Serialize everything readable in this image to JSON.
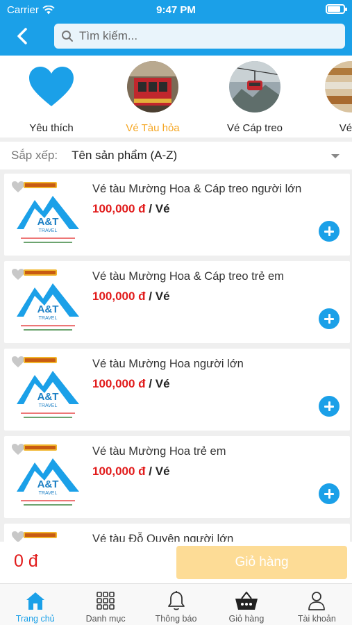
{
  "status_bar": {
    "carrier": "Carrier",
    "time": "9:47 PM"
  },
  "header": {
    "search_placeholder": "Tìm kiếm..."
  },
  "categories": [
    {
      "label": "Yêu thích",
      "icon": "heart-icon",
      "active": false
    },
    {
      "label": "Vé Tàu hỏa",
      "icon": "train-photo",
      "active": true
    },
    {
      "label": "Vé Cáp treo",
      "icon": "cable-car-photo",
      "active": false
    },
    {
      "label": "Vé B",
      "icon": "food-photo",
      "active": false
    }
  ],
  "sort": {
    "label": "Sắp xếp:",
    "value": "Tên sản phẩm (A-Z)"
  },
  "products": [
    {
      "name": "Vé tàu Mường Hoa & Cáp treo người lớn",
      "price": "100,000 đ",
      "unit": " / Vé"
    },
    {
      "name": "Vé tàu Mường Hoa & Cáp treo trẻ em",
      "price": "100,000 đ",
      "unit": " / Vé"
    },
    {
      "name": "Vé tàu Mường Hoa người lớn",
      "price": "100,000 đ",
      "unit": " / Vé"
    },
    {
      "name": "Vé tàu Mường Hoa trẻ em",
      "price": "100,000 đ",
      "unit": " / Vé"
    },
    {
      "name": "Vé tàu Đỗ Quyên người lớn",
      "price": "",
      "unit": ""
    }
  ],
  "logo_text": {
    "brand": "A&T",
    "sub": "TRAVEL"
  },
  "cart": {
    "total": "0 đ",
    "button_label": "Giỏ hàng"
  },
  "tabs": [
    {
      "label": "Trang chủ",
      "icon": "home-icon",
      "active": true
    },
    {
      "label": "Danh mục",
      "icon": "grid-icon",
      "active": false
    },
    {
      "label": "Thông báo",
      "icon": "bell-icon",
      "active": false
    },
    {
      "label": "Giỏ hàng",
      "icon": "basket-icon",
      "active": false
    },
    {
      "label": "Tài khoản",
      "icon": "user-icon",
      "active": false
    }
  ],
  "colors": {
    "primary": "#1ba0e8",
    "price": "#e11b1b",
    "active_category": "#f5a623",
    "cart_button": "#fddc96"
  }
}
